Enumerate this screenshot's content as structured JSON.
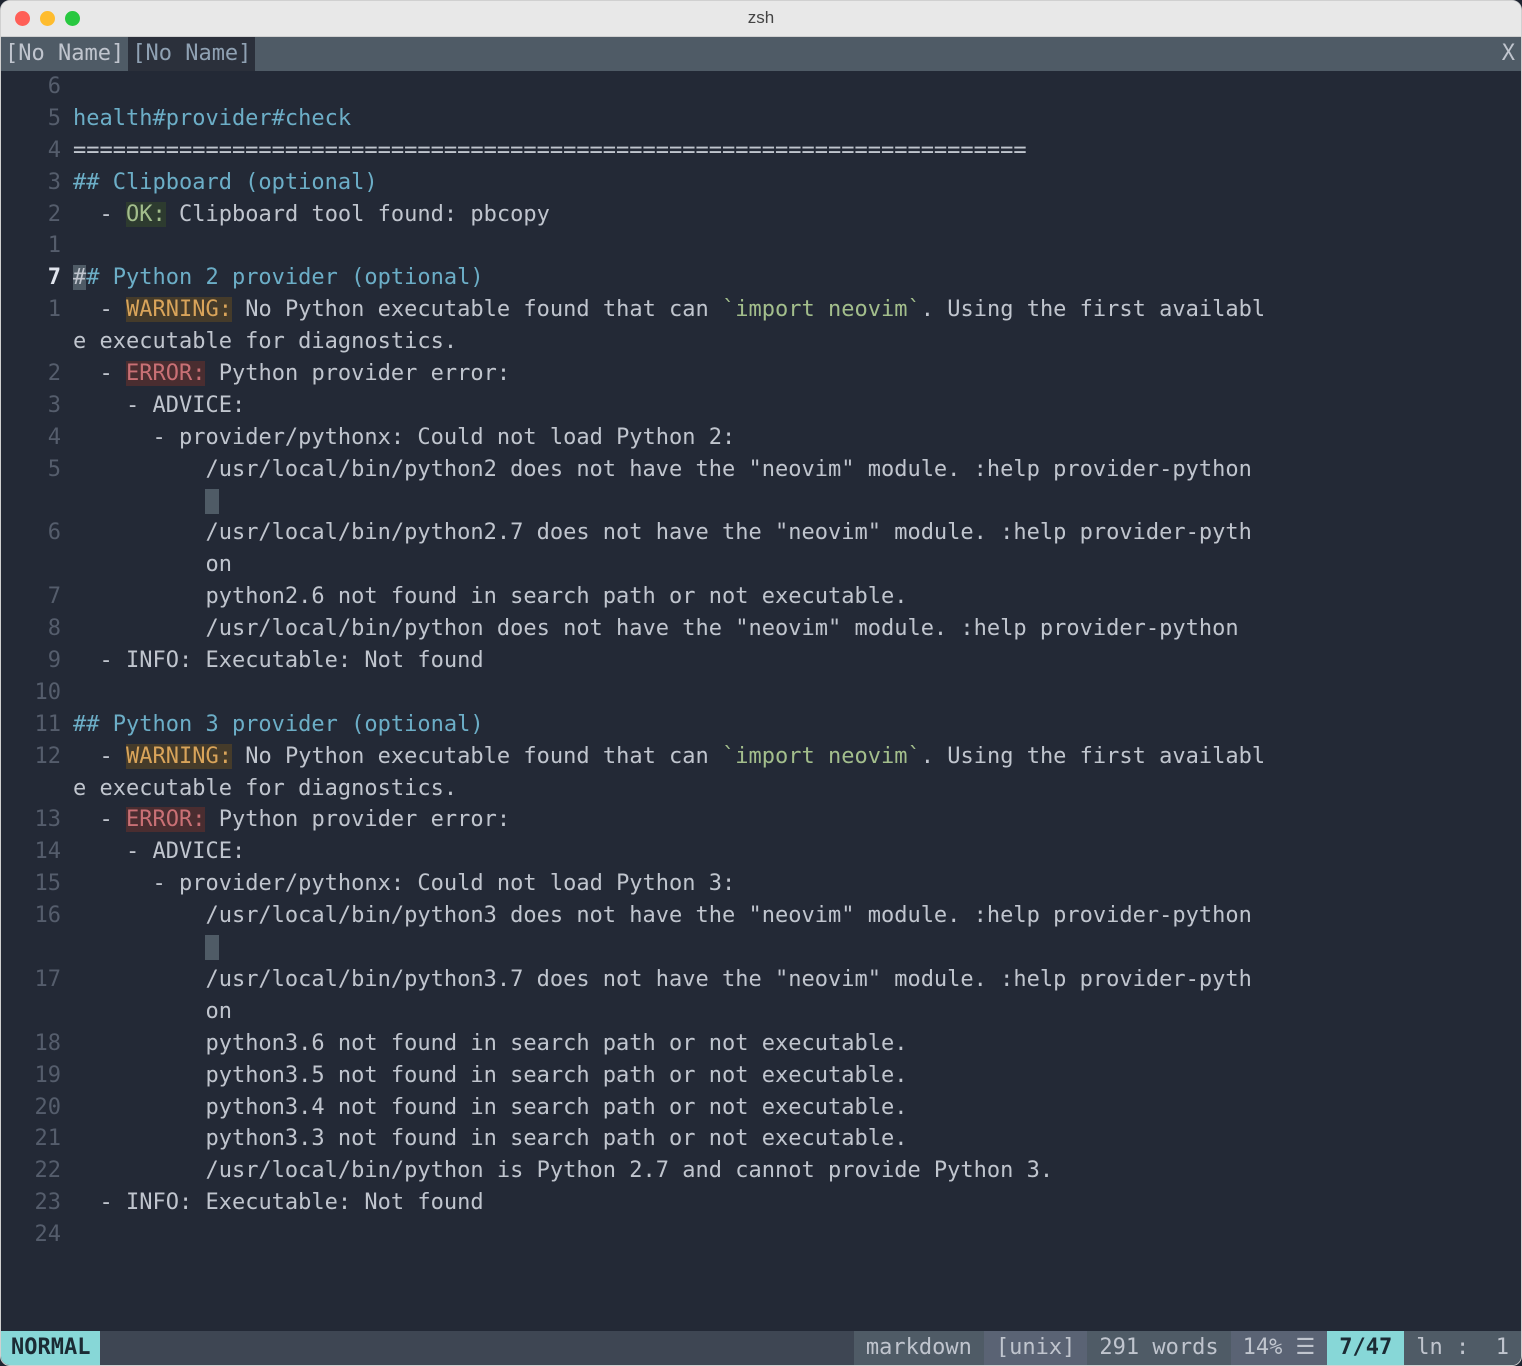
{
  "titlebar": {
    "title": "zsh"
  },
  "tabline": {
    "tabs": [
      "[No Name]",
      "[No Name]"
    ],
    "close_label": "X"
  },
  "editor": {
    "gutter": [
      "6",
      "5",
      "4",
      "3",
      "2",
      "1",
      "7",
      "1",
      "",
      "2",
      "3",
      "4",
      "5",
      "",
      "6",
      "",
      "7",
      "8",
      "9",
      "10",
      "11",
      "12",
      "",
      "13",
      "14",
      "15",
      "16",
      "",
      "17",
      "",
      "18",
      "19",
      "20",
      "21",
      "22",
      "23",
      "24"
    ],
    "current_index": 6,
    "lines": [
      {
        "segments": [
          {
            "text": ""
          }
        ]
      },
      {
        "segments": [
          {
            "text": "health#provider#check",
            "class": "hl-title"
          }
        ]
      },
      {
        "segments": [
          {
            "text": "========================================================================"
          }
        ]
      },
      {
        "segments": [
          {
            "text": "## Clipboard (optional)",
            "class": "hl-title"
          }
        ]
      },
      {
        "segments": [
          {
            "text": "  - "
          },
          {
            "text": "OK:",
            "class": "hl-ok"
          },
          {
            "text": " Clipboard tool found: pbcopy"
          }
        ]
      },
      {
        "segments": [
          {
            "text": ""
          }
        ]
      },
      {
        "segments": [
          {
            "text": "#",
            "class": "cursor-block"
          },
          {
            "text": "# Python 2 provider (optional)",
            "class": "hl-title"
          }
        ]
      },
      {
        "segments": [
          {
            "text": "  - "
          },
          {
            "text": "WARNING:",
            "class": "hl-warn"
          },
          {
            "text": " No Python executable found that can "
          },
          {
            "text": "`import neovim`",
            "class": "hl-string"
          },
          {
            "text": ". Using the first availabl"
          }
        ]
      },
      {
        "segments": [
          {
            "text": "e executable for diagnostics."
          }
        ]
      },
      {
        "segments": [
          {
            "text": "  - "
          },
          {
            "text": "ERROR:",
            "class": "hl-err"
          },
          {
            "text": " Python provider error:"
          }
        ]
      },
      {
        "segments": [
          {
            "text": "    - ADVICE:"
          }
        ]
      },
      {
        "segments": [
          {
            "text": "      - provider/pythonx: Could not load Python 2:"
          }
        ]
      },
      {
        "segments": [
          {
            "text": "          /usr/local/bin/python2 does not have the \"neovim\" module. :help provider-python"
          }
        ]
      },
      {
        "segments": [
          {
            "text": "          "
          },
          {
            "text": " ",
            "class": "cursor-block"
          }
        ]
      },
      {
        "segments": [
          {
            "text": "          /usr/local/bin/python2.7 does not have the \"neovim\" module. :help provider-pyth"
          }
        ]
      },
      {
        "segments": [
          {
            "text": "          on"
          }
        ]
      },
      {
        "segments": [
          {
            "text": "          python2.6 not found in search path or not executable."
          }
        ]
      },
      {
        "segments": [
          {
            "text": "          /usr/local/bin/python does not have the \"neovim\" module. :help provider-python"
          }
        ]
      },
      {
        "segments": [
          {
            "text": "  - INFO: Executable: Not found"
          }
        ]
      },
      {
        "segments": [
          {
            "text": ""
          }
        ]
      },
      {
        "segments": [
          {
            "text": "## Python 3 provider (optional)",
            "class": "hl-title"
          }
        ]
      },
      {
        "segments": [
          {
            "text": "  - "
          },
          {
            "text": "WARNING:",
            "class": "hl-warn"
          },
          {
            "text": " No Python executable found that can "
          },
          {
            "text": "`import neovim`",
            "class": "hl-string"
          },
          {
            "text": ". Using the first availabl"
          }
        ]
      },
      {
        "segments": [
          {
            "text": "e executable for diagnostics."
          }
        ]
      },
      {
        "segments": [
          {
            "text": "  - "
          },
          {
            "text": "ERROR:",
            "class": "hl-err"
          },
          {
            "text": " Python provider error:"
          }
        ]
      },
      {
        "segments": [
          {
            "text": "    - ADVICE:"
          }
        ]
      },
      {
        "segments": [
          {
            "text": "      - provider/pythonx: Could not load Python 3:"
          }
        ]
      },
      {
        "segments": [
          {
            "text": "          /usr/local/bin/python3 does not have the \"neovim\" module. :help provider-python"
          }
        ]
      },
      {
        "segments": [
          {
            "text": "          "
          },
          {
            "text": " ",
            "class": "cursor-block"
          }
        ]
      },
      {
        "segments": [
          {
            "text": "          /usr/local/bin/python3.7 does not have the \"neovim\" module. :help provider-pyth"
          }
        ]
      },
      {
        "segments": [
          {
            "text": "          on"
          }
        ]
      },
      {
        "segments": [
          {
            "text": "          python3.6 not found in search path or not executable."
          }
        ]
      },
      {
        "segments": [
          {
            "text": "          python3.5 not found in search path or not executable."
          }
        ]
      },
      {
        "segments": [
          {
            "text": "          python3.4 not found in search path or not executable."
          }
        ]
      },
      {
        "segments": [
          {
            "text": "          python3.3 not found in search path or not executable."
          }
        ]
      },
      {
        "segments": [
          {
            "text": "          /usr/local/bin/python is Python 2.7 and cannot provide Python 3."
          }
        ]
      },
      {
        "segments": [
          {
            "text": "  - INFO: Executable: Not found"
          }
        ]
      },
      {
        "segments": [
          {
            "text": ""
          }
        ]
      }
    ]
  },
  "statusline": {
    "mode": "NORMAL",
    "filetype": "markdown",
    "encoding": "[unix]",
    "words": "291 words",
    "percent": "14% ☰",
    "position": "7/47",
    "col_label": "ln :",
    "col_value": "1"
  }
}
